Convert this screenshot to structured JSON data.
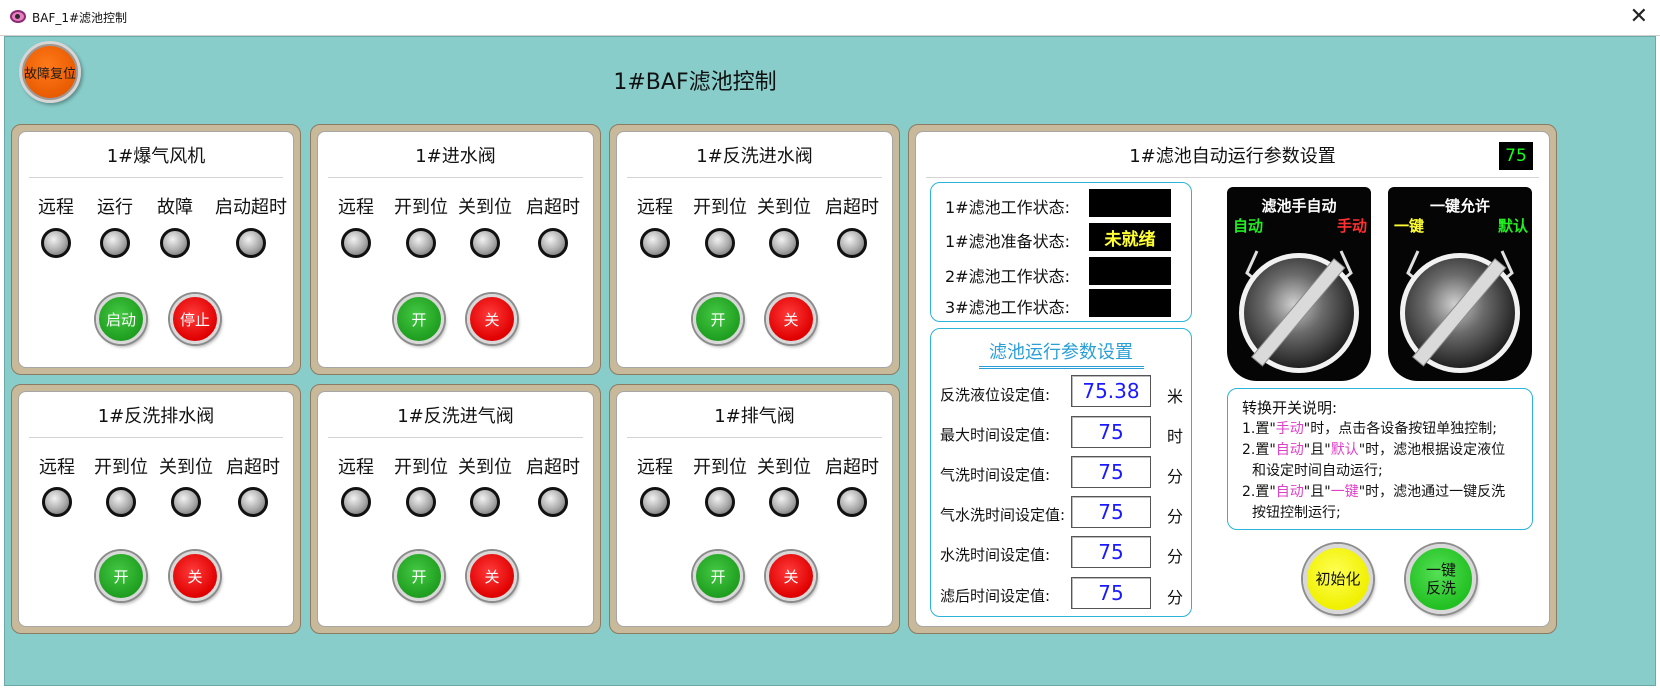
{
  "window": {
    "title": "BAF_1#滤池控制",
    "close_glyph": "✕"
  },
  "reset_button": "故障复位",
  "main_title": "1#BAF滤池控制",
  "device_panels": [
    {
      "title": "1#爆气风机",
      "lamps": [
        "远程",
        "运行",
        "故障",
        "启动超时"
      ],
      "buttons": [
        "启动",
        "停止"
      ]
    },
    {
      "title": "1#进水阀",
      "lamps": [
        "远程",
        "开到位",
        "关到位",
        "启超时"
      ],
      "buttons": [
        "开",
        "关"
      ]
    },
    {
      "title": "1#反洗进水阀",
      "lamps": [
        "远程",
        "开到位",
        "关到位",
        "启超时"
      ],
      "buttons": [
        "开",
        "关"
      ]
    },
    {
      "title": "1#反洗排水阀",
      "lamps": [
        "远程",
        "开到位",
        "关到位",
        "启超时"
      ],
      "buttons": [
        "开",
        "关"
      ]
    },
    {
      "title": "1#反洗进气阀",
      "lamps": [
        "远程",
        "开到位",
        "关到位",
        "启超时"
      ],
      "buttons": [
        "开",
        "关"
      ]
    },
    {
      "title": "1#排气阀",
      "lamps": [
        "远程",
        "开到位",
        "关到位",
        "启超时"
      ],
      "buttons": [
        "开",
        "关"
      ]
    }
  ],
  "auto_panel": {
    "title": "1#滤池自动运行参数设置",
    "counter": "75",
    "status": [
      {
        "label": "1#滤池工作状态:",
        "value": ""
      },
      {
        "label": "1#滤池准备状态:",
        "value": "未就绪"
      },
      {
        "label": "2#滤池工作状态:",
        "value": ""
      },
      {
        "label": "3#滤池工作状态:",
        "value": ""
      }
    ],
    "params_title": "滤池运行参数设置",
    "params": [
      {
        "label": "反洗液位设定值:",
        "value": "75.38",
        "unit": "米"
      },
      {
        "label": "最大时间设定值:",
        "value": "75",
        "unit": "时"
      },
      {
        "label": "气洗时间设定值:",
        "value": "75",
        "unit": "分"
      },
      {
        "label": "气水洗时间设定值:",
        "value": "75",
        "unit": "分"
      },
      {
        "label": "水洗时间设定值:",
        "value": "75",
        "unit": "分"
      },
      {
        "label": "滤后时间设定值:",
        "value": "75",
        "unit": "分"
      }
    ],
    "selectors": [
      {
        "title": "滤池手自动",
        "left": "自动",
        "right": "手动",
        "left_color": "#22ee22",
        "right_color": "#ff3030"
      },
      {
        "title": "一键允许",
        "left": "一键",
        "right": "默认",
        "left_color": "#ffff33",
        "right_color": "#22ee22"
      }
    ],
    "description": {
      "heading": "转换开关说明:",
      "l1a": "1.置\"",
      "l1b": "手动",
      "l1c": "\"时，点击各设备按钮单独控制;",
      "l2a": "2.置\"",
      "l2b": "自动",
      "l2c": "\"且\"",
      "l2d": "默认",
      "l2e": "\"时，滤池根据设定液位",
      "l3": "和设定时间自动运行;",
      "l4a": "2.置\"",
      "l4b": "自动",
      "l4c": "\"且\"",
      "l4d": "一键",
      "l4e": "\"时，滤池通过一键反洗",
      "l5": "按钮控制运行;"
    },
    "init_button": "初始化",
    "backwash_button": {
      "line1": "一键",
      "line2": "反洗"
    }
  }
}
